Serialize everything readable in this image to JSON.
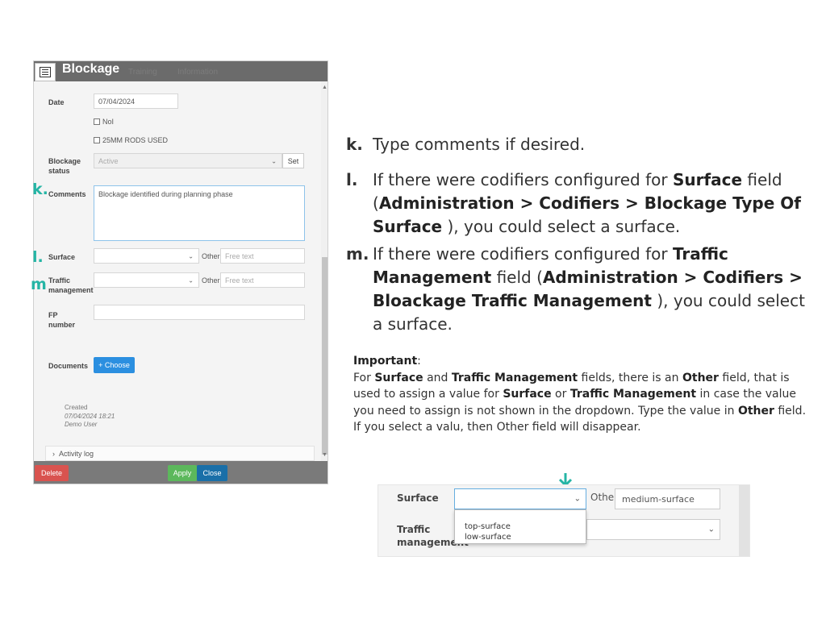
{
  "dialog": {
    "title": "Blockage",
    "ghost_tabs": [
      "Training",
      "Information"
    ],
    "fields": {
      "date_label": "Date",
      "date_value": "07/04/2024",
      "checkbox1": "NoI",
      "checkbox2": "25MM RODS USED",
      "status_label_1": "Blockage",
      "status_label_2": "status",
      "status_value": "Active",
      "set_label": "Set",
      "comments_label": "Comments",
      "comments_value": "Blockage identified during planning phase",
      "surface_label": "Surface",
      "other_label": "Other:",
      "other_placeholder": "Free text",
      "traffic_label_1": "Traffic",
      "traffic_label_2": "management",
      "fp_label_1": "FP",
      "fp_label_2": "number",
      "documents_label": "Documents",
      "choose_label": "+ Choose"
    },
    "created": {
      "label": "Created",
      "date": "07/04/2024 18:21",
      "user": "Demo User"
    },
    "activity_log": "Activity log",
    "footer": {
      "delete": "Delete",
      "apply": "Apply",
      "close": "Close"
    }
  },
  "markers": {
    "k": "k.",
    "l": "l.",
    "m": "m"
  },
  "steps": {
    "k": {
      "letter": "k.",
      "text": "Type comments if desired."
    },
    "l": {
      "letter": "l.",
      "p1": "If there were codifiers configured for ",
      "b1": "Surface",
      "p2": " field (",
      "b2": "Administration > Codifiers > Blockage Type Of Surface",
      "p3": " ), you could select a surface."
    },
    "m": {
      "letter": "m.",
      "p1": "If there were codifiers configured for ",
      "b1": "Traffic Management",
      "p2": " field (",
      "b2": "Administration > Codifiers > Bloackage Traffic Management",
      "p3": " ), you could select a surface."
    }
  },
  "important": {
    "title": "Important",
    "colon": ":",
    "t1": "For ",
    "b1": "Surface",
    "t2": " and ",
    "b2": "Traffic Management",
    "t3": " fields, there is an ",
    "b3": "Other",
    "t4": " field, that is used to assign a value for ",
    "b4": "Surface",
    "t5": " or ",
    "b5": "Traffic Management",
    "t6": " in case the value you need to assign is not shown in the dropdown. Type the value in ",
    "b6": "Other",
    "t7": " field. If you select a valu, then Other field will disappear."
  },
  "zoom": {
    "surface_label": "Surface",
    "other_label": "Other:",
    "other_value": "medium-surface",
    "traffic_label_1": "Traffic",
    "traffic_label_2": "management",
    "options": [
      "top-surface",
      "low-surface"
    ]
  },
  "colors": {
    "accent_teal": "#25b5a5",
    "header_gray": "#6b6b6b",
    "choose_blue": "#2b8fe0",
    "delete_red": "#d9534f",
    "apply_green": "#5cb85c",
    "close_blue": "#1a6fa8"
  },
  "icons": {
    "header": "list-icon",
    "arrow": "arrow-down-icon",
    "dropdown": "chevron-down-icon"
  }
}
